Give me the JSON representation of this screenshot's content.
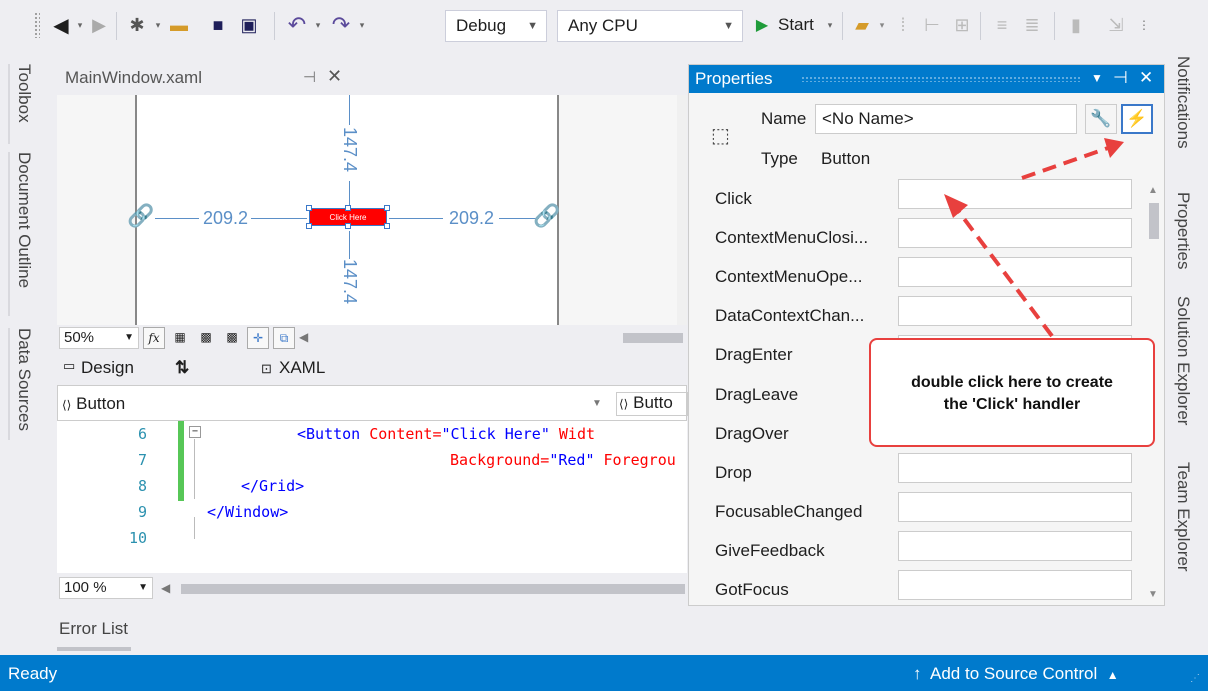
{
  "colors": {
    "accent": "#007acc",
    "button_bg": "#ff0000",
    "annotation": "#e8403e",
    "dimension": "#5b8fc7"
  },
  "toolbar": {
    "config_value": "Debug",
    "platform_value": "Any CPU",
    "start_label": "Start"
  },
  "left_tabs": [
    "Toolbox",
    "Document Outline",
    "Data Sources"
  ],
  "right_tabs": [
    "Notifications",
    "Properties",
    "Solution Explorer",
    "Team Explorer"
  ],
  "document": {
    "tab_title": "MainWindow.xaml"
  },
  "designer": {
    "dim_top": "147.4",
    "dim_bottom": "147.4",
    "dim_left": "209.2",
    "dim_right": "209.2",
    "button_text": "Click Here",
    "zoom": "50%"
  },
  "split": {
    "design_label": "Design",
    "swap_label": "⇅",
    "xaml_label": "XAML"
  },
  "nav": {
    "left": "Button",
    "right": "Butto"
  },
  "code": {
    "lines": [
      {
        "num": "6",
        "indent": "        ",
        "tag_open": "<Button",
        "attr1": " Content=",
        "val1": "\"Click Here\"",
        "attr2": " Widt",
        "val2": ""
      },
      {
        "num": "7",
        "indent": "                ",
        "tag_open": "",
        "attr1": "Background=",
        "val1": "\"Red\"",
        "attr2": " Foregrou",
        "val2": ""
      },
      {
        "num": "8",
        "indent": "    ",
        "tag_open": "</Grid>",
        "attr1": "",
        "val1": "",
        "attr2": "",
        "val2": ""
      },
      {
        "num": "9",
        "indent": "",
        "tag_open": "</Window>",
        "attr1": "",
        "val1": "",
        "attr2": "",
        "val2": ""
      },
      {
        "num": "10",
        "indent": "",
        "tag_open": "",
        "attr1": "",
        "val1": "",
        "attr2": "",
        "val2": ""
      }
    ],
    "zoom": "100 %"
  },
  "error_list": "Error List",
  "properties": {
    "title": "Properties",
    "name_label": "Name",
    "name_value": "<No Name>",
    "type_label": "Type",
    "type_value": "Button",
    "events": [
      "Click",
      "ContextMenuClosi...",
      "ContextMenuOpe...",
      "DataContextChan...",
      "DragEnter",
      "DragLeave",
      "DragOver",
      "Drop",
      "FocusableChanged",
      "GiveFeedback",
      "GotFocus"
    ]
  },
  "callout": {
    "line1": "double click here to create",
    "line2": "the 'Click' handler"
  },
  "status": {
    "ready": "Ready",
    "source_control": "Add to Source Control"
  }
}
